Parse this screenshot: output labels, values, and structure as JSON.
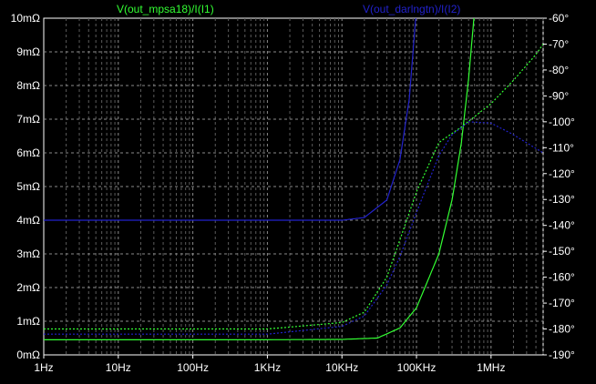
{
  "chart_data": {
    "type": "line",
    "traces": [
      {
        "name": "V(out_mpsa18)/I(I1)",
        "color": "#33ff33"
      },
      {
        "name": "V(out_darlngtn)/I(I2)",
        "color": "#2222cc"
      }
    ],
    "x_scale": "log",
    "x_range_hz": [
      1,
      5000000
    ],
    "x_ticks": [
      {
        "label": "1Hz",
        "value": 1
      },
      {
        "label": "10Hz",
        "value": 10
      },
      {
        "label": "100Hz",
        "value": 100
      },
      {
        "label": "1KHz",
        "value": 1000
      },
      {
        "label": "10KHz",
        "value": 10000
      },
      {
        "label": "100KHz",
        "value": 100000
      },
      {
        "label": "1MHz",
        "value": 1000000
      }
    ],
    "y_left_unit": "mΩ",
    "y_left_range": [
      0,
      10
    ],
    "y_left_ticks": [
      "0mΩ",
      "1mΩ",
      "2mΩ",
      "3mΩ",
      "4mΩ",
      "5mΩ",
      "6mΩ",
      "7mΩ",
      "8mΩ",
      "9mΩ",
      "10mΩ"
    ],
    "y_right_unit": "deg",
    "y_right_range": [
      -190,
      -60
    ],
    "y_right_ticks": [
      "-60°",
      "-70°",
      "-80°",
      "-90°",
      "-100°",
      "-110°",
      "-120°",
      "-130°",
      "-140°",
      "-150°",
      "-160°",
      "-170°",
      "-180°",
      "-190°"
    ],
    "grid": true,
    "series": [
      {
        "name": "V(out_mpsa18)/I(I1) magnitude",
        "color": "#33ff33",
        "style": "solid",
        "axis": "left",
        "points": [
          [
            1,
            0.45
          ],
          [
            1000,
            0.45
          ],
          [
            10000,
            0.46
          ],
          [
            30000,
            0.5
          ],
          [
            60000,
            0.8
          ],
          [
            100000,
            1.4
          ],
          [
            200000,
            3.0
          ],
          [
            300000,
            4.6
          ],
          [
            400000,
            6.3
          ],
          [
            500000,
            8.2
          ],
          [
            600000,
            10.2
          ]
        ]
      },
      {
        "name": "V(out_mpsa18)/I(I1) phase",
        "color": "#33ff33",
        "style": "dashed",
        "axis": "right",
        "points": [
          [
            1,
            -180
          ],
          [
            1000,
            -180
          ],
          [
            10000,
            -177.5
          ],
          [
            20000,
            -173.5
          ],
          [
            40000,
            -160
          ],
          [
            70000,
            -140
          ],
          [
            100000,
            -127
          ],
          [
            200000,
            -108
          ],
          [
            400000,
            -102
          ],
          [
            600000,
            -98
          ],
          [
            1000000,
            -93
          ],
          [
            2000000,
            -84
          ],
          [
            4000000,
            -74
          ],
          [
            5000000,
            -70
          ]
        ]
      },
      {
        "name": "V(out_darlngtn)/I(I2) magnitude",
        "color": "#2222cc",
        "style": "solid",
        "axis": "left",
        "points": [
          [
            1,
            4.0
          ],
          [
            10000,
            4.0
          ],
          [
            20000,
            4.08
          ],
          [
            40000,
            4.6
          ],
          [
            60000,
            5.8
          ],
          [
            80000,
            7.6
          ],
          [
            100000,
            10.3
          ]
        ]
      },
      {
        "name": "V(out_darlngtn)/I(I2) phase",
        "color": "#2222cc",
        "style": "dashed",
        "axis": "right",
        "points": [
          [
            1,
            -182
          ],
          [
            1000,
            -182
          ],
          [
            10000,
            -179
          ],
          [
            20000,
            -175
          ],
          [
            40000,
            -163
          ],
          [
            60000,
            -152
          ],
          [
            100000,
            -135
          ],
          [
            200000,
            -113
          ],
          [
            300000,
            -105
          ],
          [
            500000,
            -100
          ],
          [
            1000000,
            -100.5
          ],
          [
            2000000,
            -105
          ],
          [
            5000000,
            -112
          ]
        ]
      }
    ]
  }
}
